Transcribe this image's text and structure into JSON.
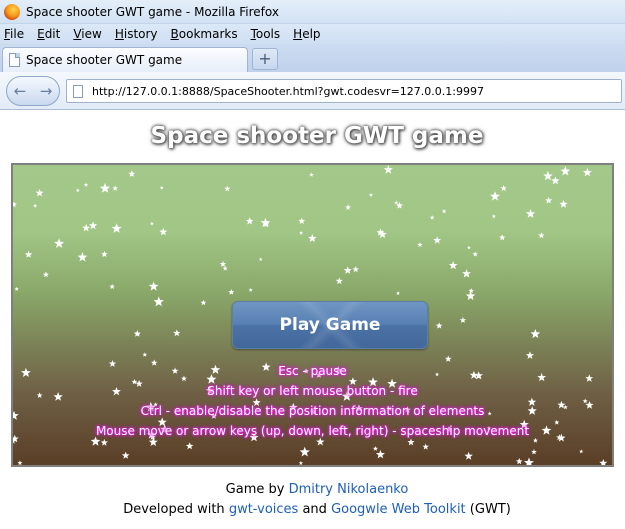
{
  "window": {
    "title": "Space shooter GWT game - Mozilla Firefox"
  },
  "menu": [
    "File",
    "Edit",
    "View",
    "History",
    "Bookmarks",
    "Tools",
    "Help"
  ],
  "tab": {
    "label": "Space shooter GWT game",
    "new_tab_symbol": "+"
  },
  "nav": {
    "back_symbol": "←",
    "forward_symbol": "→",
    "url": "http://127.0.0.1:8888/SpaceShooter.html?gwt.codesvr=127.0.0.1:9997"
  },
  "page": {
    "title": "Space shooter GWT game"
  },
  "game": {
    "play_button_label": "Play Game",
    "help_lines": [
      "Esc - pause",
      "Shift key or left mouse button - fire",
      "Ctrl - enable/disable the position information of elements",
      "Mouse move or arrow keys (up, down, left, right) - spaceship movement"
    ],
    "colors": {
      "sky_top": "#a3c88a",
      "ground_bottom": "#5a3e26",
      "button": "#5880b3",
      "help_glow": "#ff1aff"
    }
  },
  "footer": {
    "line1_prefix": "Game by",
    "author_link": "Dmitry Nikolaenko",
    "line2_prefix": "Developed with",
    "lib_link": "gwt-voices",
    "and": "and",
    "gwt_link": "Googwle Web Toolkit",
    "line2_suffix": "(GWT)"
  }
}
